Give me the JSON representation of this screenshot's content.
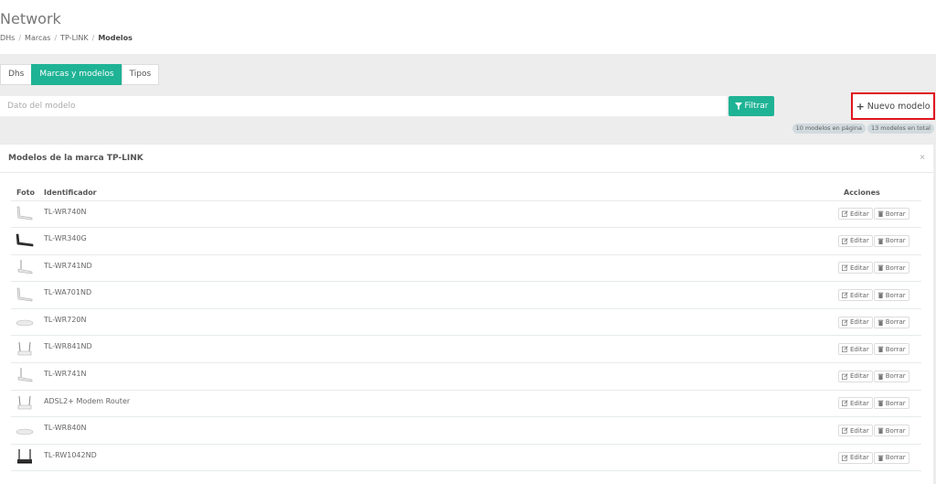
{
  "header": {
    "title": "Network",
    "breadcrumb": [
      {
        "label": "DHs"
      },
      {
        "label": "Marcas"
      },
      {
        "label": "TP-LINK"
      },
      {
        "label": "Modelos"
      }
    ]
  },
  "tabs": [
    {
      "label": "Dhs",
      "active": false
    },
    {
      "label": "Marcas y modelos",
      "active": true
    },
    {
      "label": "Tipos",
      "active": false
    }
  ],
  "search": {
    "placeholder": "Dato del modelo",
    "value": ""
  },
  "filter_button": {
    "label": "Filtrar",
    "icon": "filter-icon"
  },
  "new_model_button": {
    "label": "Nuevo modelo",
    "icon": "plus-icon"
  },
  "badges": {
    "per_page": "10 modelos en página",
    "total": "13 modelos en total"
  },
  "panel": {
    "title": "Modelos de la marca TP-LINK",
    "close_icon": "×",
    "columns": {
      "photo": "Foto",
      "identifier": "Identificador",
      "actions": "Acciones"
    },
    "edit_label": "Editar",
    "delete_label": "Borrar",
    "rows": [
      {
        "identifier": "TL-WR740N",
        "thumb": "white-router"
      },
      {
        "identifier": "TL-WR340G",
        "thumb": "black-router"
      },
      {
        "identifier": "TL-WR741ND",
        "thumb": "white-router-antenna"
      },
      {
        "identifier": "TL-WA701ND",
        "thumb": "white-router"
      },
      {
        "identifier": "TL-WR720N",
        "thumb": "flat-router"
      },
      {
        "identifier": "TL-WR841ND",
        "thumb": "dual-antenna-router"
      },
      {
        "identifier": "TL-WR741N",
        "thumb": "white-router-antenna"
      },
      {
        "identifier": "ADSL2+ Modem Router",
        "thumb": "dual-antenna-router"
      },
      {
        "identifier": "TL-WR840N",
        "thumb": "flat-router"
      },
      {
        "identifier": "TL-RW1042ND",
        "thumb": "black-dual-antenna-router"
      }
    ]
  },
  "colors": {
    "accent": "#1fb395",
    "highlight": "#e0151e"
  }
}
